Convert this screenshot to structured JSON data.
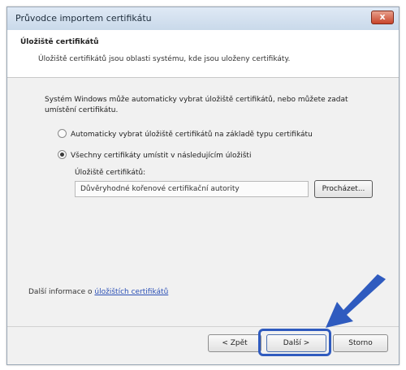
{
  "window": {
    "title": "Průvodce importem certifikátu",
    "close_glyph": "x"
  },
  "header": {
    "title": "Úložiště certifikátů",
    "description": "Úložiště certifikátů jsou oblasti systému, kde jsou uloženy certifikáty."
  },
  "content": {
    "intro": "Systém Windows může automaticky vybrat úložiště certifikátů, nebo můžete zadat umístění certifikátu.",
    "radio_auto": "Automaticky vybrat úložiště certifikátů na základě typu certifikátu",
    "radio_manual": "Všechny certifikáty umístit v následujícím úložišti",
    "selected_option": "manual",
    "store_label": "Úložiště certifikátů:",
    "store_value": "Důvěryhodné kořenové certifikační autority",
    "browse_label": "Procházet..."
  },
  "footer": {
    "more_info_prefix": "Další informace o ",
    "more_info_link": "úložištích certifikátů",
    "back_label": "< Zpět",
    "next_label": "Další >",
    "cancel_label": "Storno"
  },
  "colors": {
    "arrow": "#2f5bbf",
    "highlight": "#2f5bbf",
    "close_button": "#c8442a"
  }
}
